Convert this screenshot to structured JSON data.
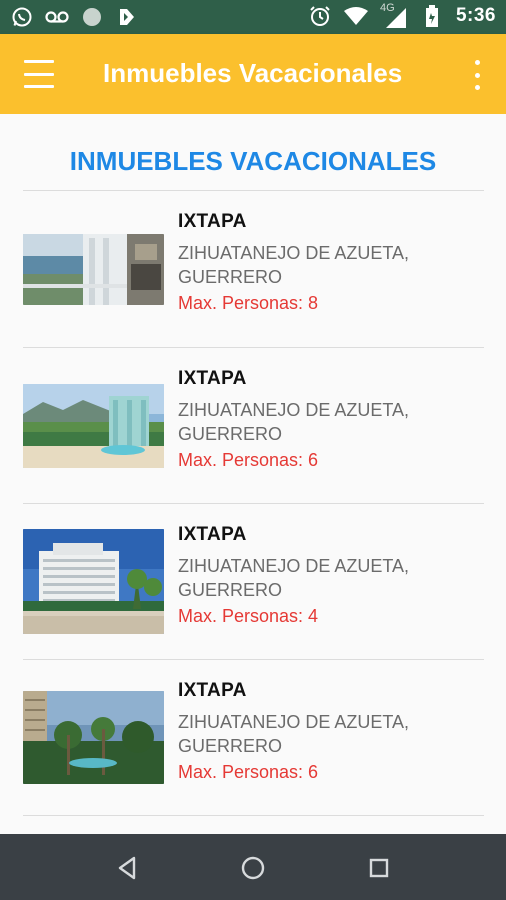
{
  "status_bar": {
    "time": "5:36",
    "network": "4G",
    "icons": [
      "whatsapp-icon",
      "voicemail-icon",
      "circle-icon",
      "app-icon",
      "alarm-icon",
      "wifi-icon",
      "signal-icon",
      "battery-icon"
    ]
  },
  "app_bar": {
    "title": "Inmuebles Vacacionales",
    "menu_icon": "hamburger-menu-icon",
    "overflow_icon": "more-vert-icon",
    "background": "#fbc02d"
  },
  "page": {
    "heading": "INMUEBLES VACACIONALES",
    "heading_color": "#1e88e5"
  },
  "listings": [
    {
      "city": "IXTAPA",
      "address": "ZIHUATANEJO DE AZUETA, GUERRERO",
      "max": "Max. Personas: 8"
    },
    {
      "city": "IXTAPA",
      "address": "ZIHUATANEJO DE AZUETA, GUERRERO",
      "max": "Max. Personas: 6"
    },
    {
      "city": "IXTAPA",
      "address": "ZIHUATANEJO DE AZUETA, GUERRERO",
      "max": "Max. Personas: 4"
    },
    {
      "city": "IXTAPA",
      "address": "ZIHUATANEJO DE AZUETA, GUERRERO",
      "max": "Max. Personas: 6"
    }
  ],
  "nav_bar": {
    "back_icon": "back-triangle-icon",
    "home_icon": "home-circle-icon",
    "recents_icon": "recents-square-icon"
  }
}
